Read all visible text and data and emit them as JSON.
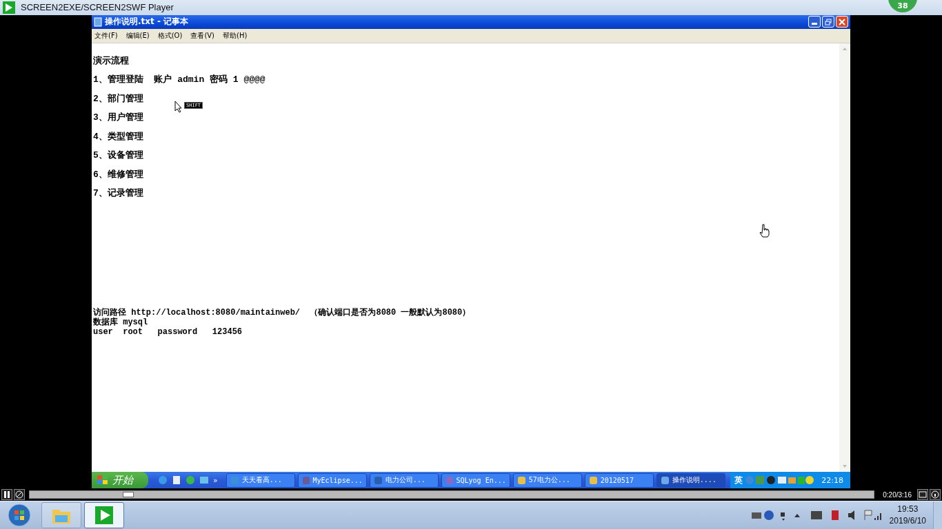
{
  "player": {
    "title": "SCREEN2EXE/SCREEN2SWF Player",
    "badge": "38"
  },
  "notepad": {
    "title": "操作说明.txt - 记事本",
    "menu": [
      "文件(F)",
      "编辑(E)",
      "格式(O)",
      "查看(V)",
      "帮助(H)"
    ],
    "heading": "演示流程",
    "steps": [
      "1、管理登陆  账户 admin 密码 1 @@@@",
      "2、部门管理",
      "3、用户管理",
      "4、类型管理",
      "5、设备管理",
      "6、维修管理",
      "7、记录管理"
    ],
    "info_lines": [
      "访问路径 http://localhost:8080/maintainweb/  （确认端口是否为8080 一般默认为8080）",
      "数据库 mysql",
      "user  root   password   123456"
    ]
  },
  "cursor": {
    "key": "SHIFT"
  },
  "xp_taskbar": {
    "start": "开始",
    "more": "»",
    "tasks": [
      {
        "label": "天天看高...",
        "kind": "chat",
        "selected": false
      },
      {
        "label": "MyEclipse...",
        "kind": "eclipse",
        "selected": false
      },
      {
        "label": "电力公司...",
        "kind": "document",
        "selected": false
      },
      {
        "label": "SQLyog En...",
        "kind": "database",
        "selected": false
      },
      {
        "label": "57电力公...",
        "kind": "folder",
        "selected": false
      },
      {
        "label": "20120517",
        "kind": "folder",
        "selected": false
      },
      {
        "label": "操作说明....",
        "kind": "notepad",
        "selected": true
      }
    ],
    "ime": "英",
    "clock": "22:18"
  },
  "playback": {
    "playing": true,
    "level": 0.11,
    "time": "0:20/3:16"
  },
  "win7_taskbar": {
    "pinned": [
      {
        "kind": "explorer",
        "selected": false
      },
      {
        "kind": "player",
        "selected": true
      }
    ],
    "clock": "19:53",
    "date": "2019/6/10"
  }
}
